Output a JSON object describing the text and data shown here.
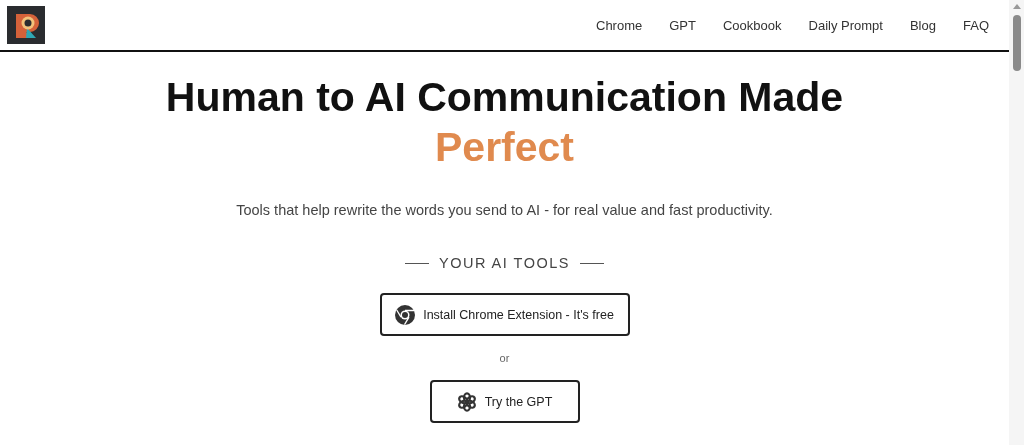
{
  "nav": {
    "links": [
      "Chrome",
      "GPT",
      "Cookbook",
      "Daily Prompt",
      "Blog",
      "FAQ"
    ]
  },
  "hero": {
    "title": "Human to AI Communication Made",
    "highlight": "Perfect",
    "subtitle": "Tools that help rewrite the words you send to AI - for real value and fast productivity."
  },
  "tools": {
    "heading": "YOUR AI TOOLS",
    "separator": "or",
    "buttons": [
      {
        "kind": "chrome",
        "label": "Install Chrome Extension - It's free"
      },
      {
        "kind": "gpt",
        "label": "Try the GPT"
      }
    ]
  }
}
